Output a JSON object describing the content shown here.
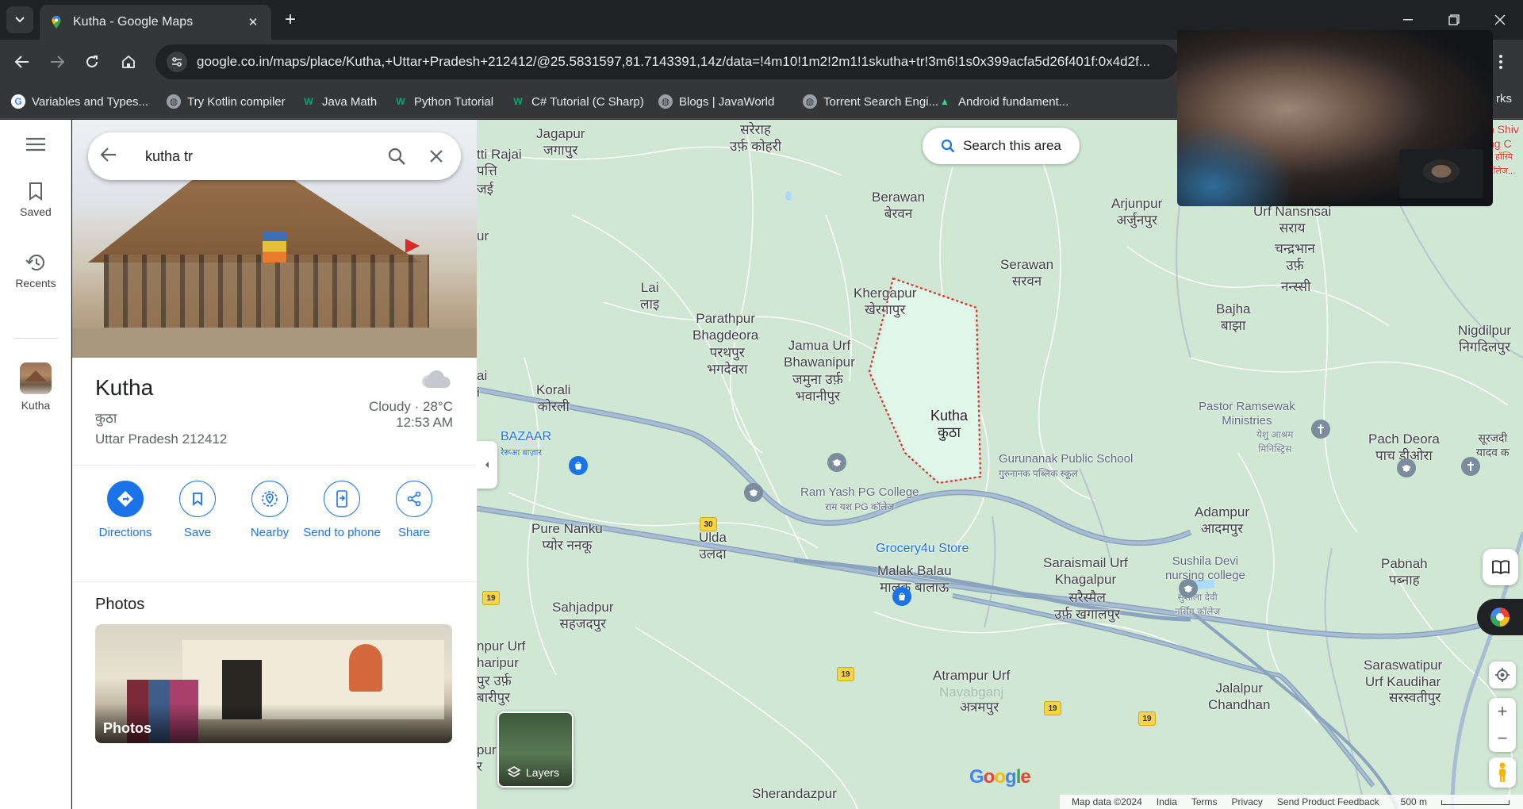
{
  "browser": {
    "tab_title": "Kutha - Google Maps",
    "url": "google.co.in/maps/place/Kutha,+Uttar+Pradesh+212412/@25.5831597,81.7143391,14z/data=!4m10!1m2!2m1!1skutha+tr!3m6!1s0x399acfa5d26f401f:0x4d2f...",
    "bookmarks": [
      {
        "label": "Variables and Types...",
        "icon": "google-icon"
      },
      {
        "label": "Try Kotlin compiler",
        "icon": "globe-icon"
      },
      {
        "label": "Java Math",
        "icon": "w3schools-icon"
      },
      {
        "label": "Python Tutorial",
        "icon": "w3schools-icon"
      },
      {
        "label": "C# Tutorial (C Sharp)",
        "icon": "w3schools-icon"
      },
      {
        "label": "Blogs | JavaWorld",
        "icon": "globe-icon"
      },
      {
        "label": "Torrent Search Engi...",
        "icon": "globe-icon"
      },
      {
        "label": "Android fundament...",
        "icon": "android-icon"
      }
    ],
    "bookmarks_overflow": "rks"
  },
  "rail": {
    "saved_label": "Saved",
    "recents_label": "Recents",
    "recent_place_label": "Kutha"
  },
  "search": {
    "query": "kutha tr"
  },
  "place": {
    "name": "Kutha",
    "alt_name": "कुठा",
    "address": "Uttar Pradesh 212412",
    "weather": "Cloudy · 28°C",
    "time": "12:53 AM"
  },
  "actions": [
    {
      "label": "Directions"
    },
    {
      "label": "Save"
    },
    {
      "label": "Nearby"
    },
    {
      "label": "Send to phone"
    },
    {
      "label": "Share"
    }
  ],
  "photos": {
    "title": "Photos",
    "card_label": "Photos"
  },
  "map": {
    "search_area_label": "Search this area",
    "layers_label": "Layers",
    "footer": {
      "data": "Map data ©2024",
      "country": "India",
      "terms": "Terms",
      "privacy": "Privacy",
      "feedback": "Send Product Feedback",
      "scale": "500 m"
    },
    "labels": [
      {
        "text": "Jagapur",
        "alt": "जगापुर"
      },
      {
        "text": "सरेराह",
        "alt": "उर्फ़ कोहरी"
      },
      {
        "text": "Berawan",
        "alt": "बेरवन"
      },
      {
        "text": "Arjunpur",
        "alt": "अर्जुनपुर"
      },
      {
        "text": "Urf Nansnsai",
        "alt": "सराय"
      },
      {
        "text": "चन्द्रभान",
        "alt": "उर्फ़"
      },
      {
        "text": "नन्स्सी",
        "alt": ""
      },
      {
        "text": "Serawan",
        "alt": "सरवन"
      },
      {
        "text": "Khergapur",
        "alt": "खेरगापुर"
      },
      {
        "text": "Lai",
        "alt": "लाइ"
      },
      {
        "text": "Parathpur",
        "alt": "Bhagdeora"
      },
      {
        "text": "परथपुर",
        "alt": "भगदेवरा"
      },
      {
        "text": "Jamua Urf",
        "alt": "Bhawanipur"
      },
      {
        "text": "जमुना उर्फ़",
        "alt": "भवानीपुर"
      },
      {
        "text": "Bajha",
        "alt": "बाझा"
      },
      {
        "text": "Nigdilpur",
        "alt": "निगदिलपुर"
      },
      {
        "text": "Korali",
        "alt": "कोरली"
      },
      {
        "text": "Kutha",
        "alt": "कुठा"
      },
      {
        "text": "Pastor Ramsewak",
        "alt": "Ministries"
      },
      {
        "text": "येशु आश्रम",
        "alt": "मिनिस्ट्रिस"
      },
      {
        "text": "Pach Deora",
        "alt": "पाच डीओरा"
      },
      {
        "text": "सूरजदी",
        "alt": "यादव क"
      },
      {
        "text": "Gurunanak Public School",
        "alt": "गुरुनानक पब्लिक स्कूल"
      },
      {
        "text": "BAZAAR",
        "alt": "रेरूआ बाज़ार"
      },
      {
        "text": "Ram Yash PG College",
        "alt": "राम यश PG कॉलेज"
      },
      {
        "text": "Adampur",
        "alt": "आदमपुर"
      },
      {
        "text": "Pure Nanku",
        "alt": "प्योर ननकू"
      },
      {
        "text": "Ulda",
        "alt": "उलदा"
      },
      {
        "text": "Grocery4u Store",
        "alt": ""
      },
      {
        "text": "Malak Balau",
        "alt": "मालक बालाऊ"
      },
      {
        "text": "Saraismail Urf",
        "alt": "Khagalpur"
      },
      {
        "text": "सरैस्मैल",
        "alt": "उर्फ़ खगालपुर"
      },
      {
        "text": "Sushila Devi",
        "alt": "nursing college"
      },
      {
        "text": "सुशीला देवी",
        "alt": "नर्सिंग कॉलेज"
      },
      {
        "text": "Pabnah",
        "alt": "पब्नाह"
      },
      {
        "text": "Sahjadpur",
        "alt": "सहजदपुर"
      },
      {
        "text": "Atrampur Urf",
        "alt": "Navabganj"
      },
      {
        "text": "अत्रमपुर",
        "alt": ""
      },
      {
        "text": "Jalalpur",
        "alt": "Chandhan"
      },
      {
        "text": "Saraswatipur",
        "alt": "Urf Kaudihar"
      },
      {
        "text": "सरस्वतीपुर",
        "alt": ""
      },
      {
        "text": "Sherandazpur",
        "alt": ""
      },
      {
        "text": "tti Rajai",
        "alt": "पत्ति"
      },
      {
        "text": "जई",
        "alt": ""
      },
      {
        "text": "ur",
        "alt": ""
      },
      {
        "text": "ai",
        "alt": "i"
      },
      {
        "text": "npur Urf",
        "alt": "haripur"
      },
      {
        "text": "पुर उर्फ़",
        "alt": "बारीपुर"
      },
      {
        "text": "pur",
        "alt": "र"
      },
      {
        "text": "n Shiv",
        "alt": "ng C"
      },
      {
        "text": "न हॉस्पि",
        "alt": "ॉलेज..."
      }
    ],
    "highways": [
      "30",
      "19",
      "19",
      "19",
      "19"
    ],
    "colors": {
      "boundary": "#d93025",
      "region": "#dff7e8",
      "water": "#aadaff"
    }
  }
}
